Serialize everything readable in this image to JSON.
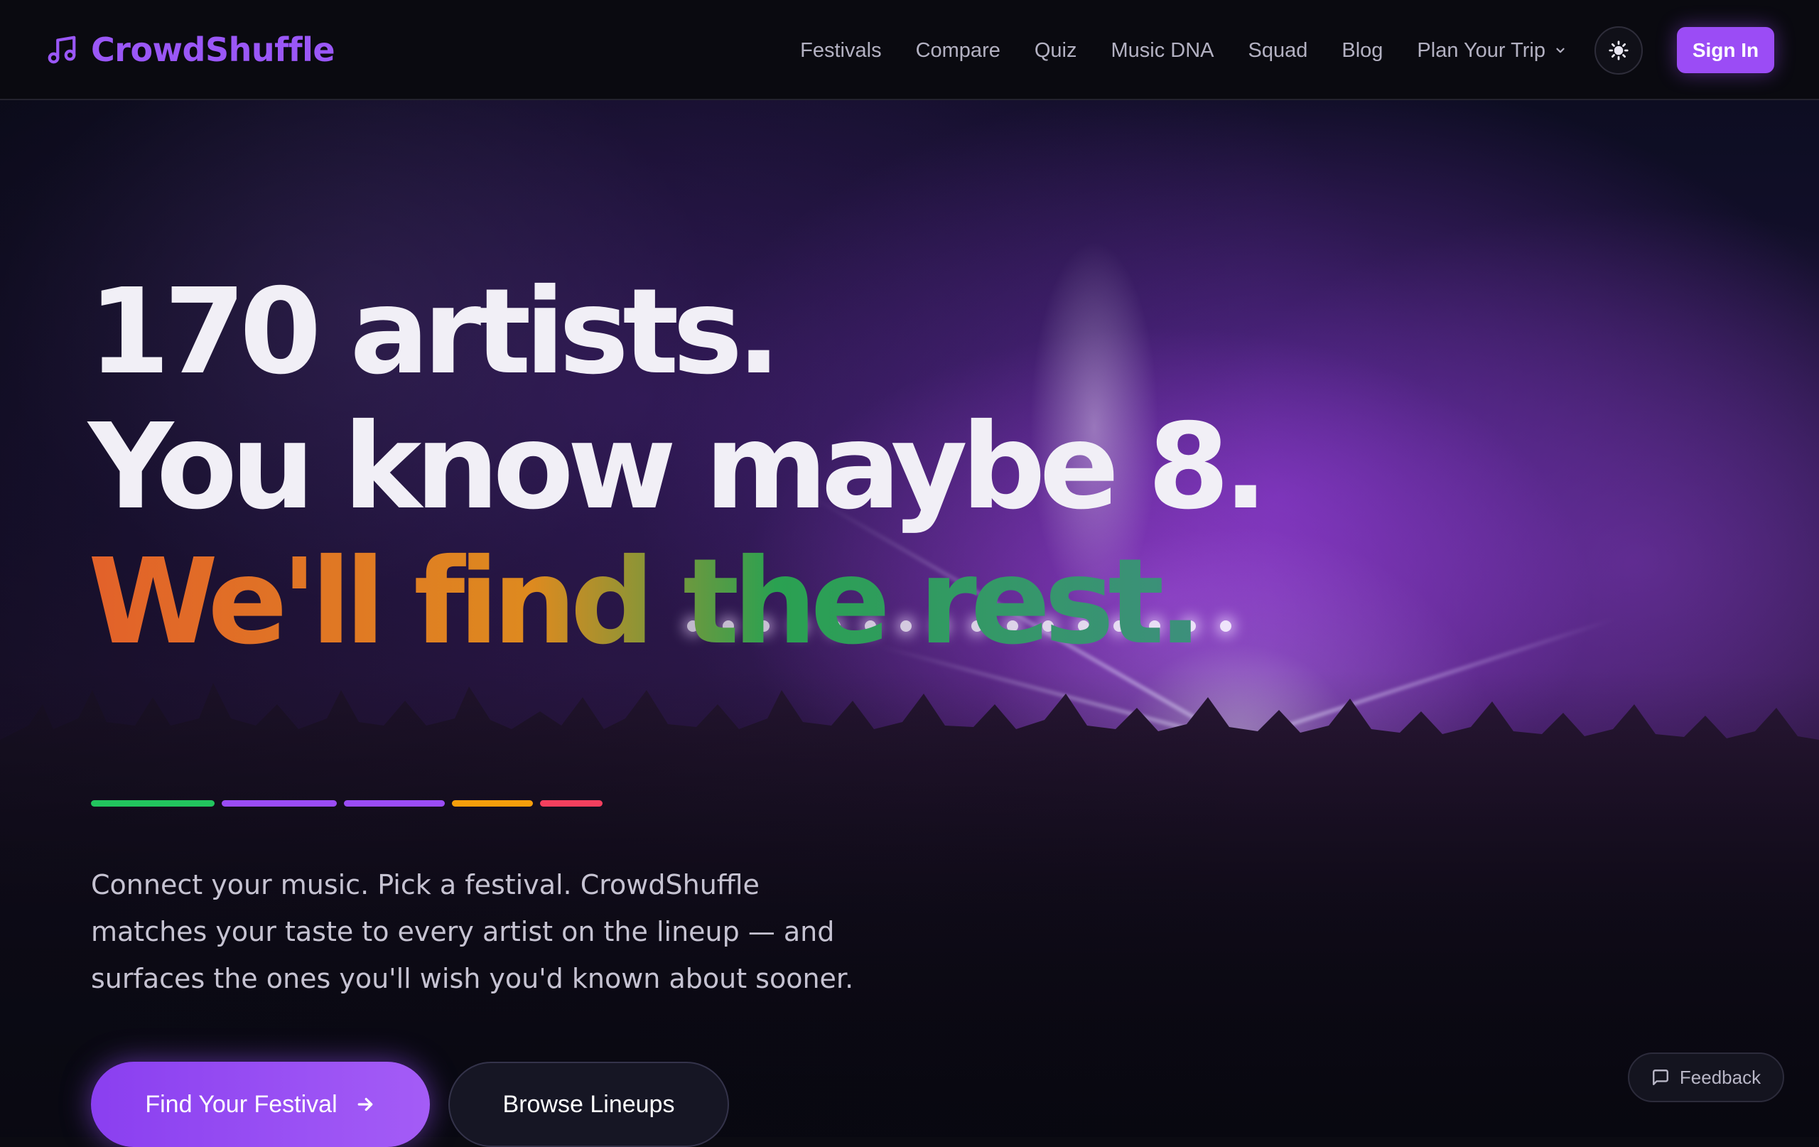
{
  "brand": {
    "name": "CrowdShuffle",
    "logo_icon": "music-note-icon",
    "accent_color": "#9b4cf5"
  },
  "nav": {
    "links": [
      {
        "label": "Festivals"
      },
      {
        "label": "Compare"
      },
      {
        "label": "Quiz"
      },
      {
        "label": "Music DNA"
      },
      {
        "label": "Squad"
      },
      {
        "label": "Blog"
      },
      {
        "label": "Plan Your Trip",
        "icon": "chevron-down-icon"
      }
    ],
    "theme_toggle_icon": "sun-icon",
    "sign_in_label": "Sign In"
  },
  "hero": {
    "headline_line_1": "170 artists.",
    "headline_line_2": "You know maybe 8.",
    "headline_line_3": "We'll find the rest.",
    "accent_bar_colors": [
      "#22c55e",
      "#9b4cf5",
      "#9b4cf5",
      "#f59e0b",
      "#f43f5e"
    ],
    "subtitle": "Connect your music. Pick a festival. CrowdShuffle matches your taste to every artist on the lineup — and surfaces the ones you'll wish you'd known about sooner.",
    "primary_cta": {
      "label": "Find Your Festival",
      "icon": "arrow-right-icon"
    },
    "secondary_cta": {
      "label": "Browse Lineups"
    },
    "background_image": "festival-crowd-photo"
  },
  "feedback": {
    "label": "Feedback",
    "icon": "message-square-icon"
  }
}
